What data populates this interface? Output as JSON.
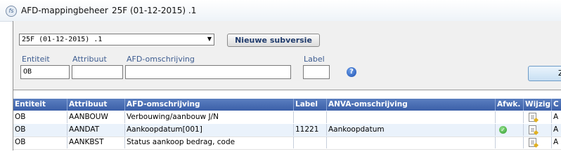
{
  "window": {
    "title": "AFD-mappingbeheer",
    "version": "25F (01-12-2015) .1",
    "icon": "app-logo-icon"
  },
  "filters": {
    "version_select": "25F (01-12-2015) .1",
    "new_subversion_button": "Nieuwe subversie",
    "labels": {
      "entiteit": "Entiteit",
      "attribuut": "Attribuut",
      "afd_omschrijving": "AFD-omschrijving",
      "label": "Label"
    },
    "values": {
      "entiteit": "OB",
      "attribuut": "",
      "afd_omschrijving": "",
      "label": ""
    },
    "search_button": "Zo"
  },
  "grid": {
    "columns": [
      "Entiteit",
      "Attribuut",
      "AFD-omschrijving",
      "Label",
      "ANVA-omschrijving",
      "Afwk.",
      "Wijzig",
      "C"
    ],
    "rows": [
      {
        "entiteit": "OB",
        "attribuut": "AANBOUW",
        "afd": "Verbouwing/aanbouw J/N",
        "label": "",
        "anva": "",
        "afwk": false,
        "extra": "A"
      },
      {
        "entiteit": "OB",
        "attribuut": "AANDAT",
        "afd": "Aankoopdatum[001]",
        "label": "11221",
        "anva": "Aankoopdatum",
        "afwk": true,
        "extra": "A"
      },
      {
        "entiteit": "OB",
        "attribuut": "AANKBST",
        "afd": "Status aankoop bedrag, code",
        "label": "",
        "anva": "",
        "afwk": false,
        "extra": "A"
      }
    ]
  },
  "colors": {
    "header_bg": "#3b5fa8",
    "label_text": "#3d5c90",
    "selected_row": "#eaf2fb"
  }
}
